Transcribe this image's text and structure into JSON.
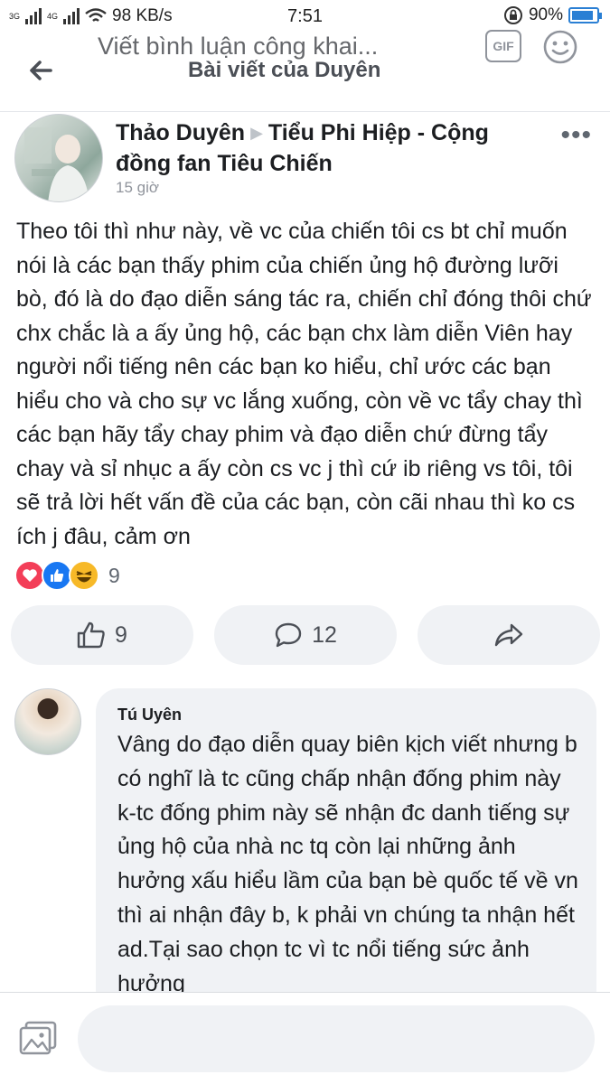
{
  "status_bar": {
    "network_left": "3G",
    "network_right": "4G",
    "speed": "98 KB/s",
    "time": "7:51",
    "battery": "90%",
    "battery_level": 0.9
  },
  "header": {
    "title": "Bài viết của Duyên"
  },
  "post": {
    "author": "Thảo Duyên",
    "group": "Tiểu Phi Hiệp - Cộng đồng fan Tiêu Chiến",
    "time": "15 giờ",
    "body": "Theo tôi thì như này, về vc của chiến tôi cs bt chỉ muốn nói là các bạn thấy phim của chiến ủng hộ đường lưỡi bò, đó là do đạo diễn sáng tác ra, chiến chỉ đóng thôi chứ chx chắc là a ấy ủng hộ, các bạn chx làm diễn Viên hay người nổi tiếng nên các bạn ko hiểu, chỉ ước các bạn hiểu cho và cho sự vc lắng xuống, còn về vc tẩy chay thì các bạn hãy tẩy chay phim và đạo diễn chứ đừng tẩy chay và sỉ nhục a ấy còn cs vc j thì cứ ib riêng vs tôi, tôi sẽ trả lời hết vấn đề của các bạn, còn cãi nhau thì ko cs ích j đâu, cảm ơn",
    "reaction_count": "9",
    "reactions": [
      "love",
      "like",
      "haha"
    ],
    "like_count": "9",
    "comment_count": "12"
  },
  "comment": {
    "author": "Tú Uyên",
    "body": "Vâng do đạo diễn quay biên kịch viết nhưng b có nghĩ là tc cũng chấp nhận đống phim này k-tc đống phim này sẽ nhận đc danh tiếng sự ủng hộ của nhà nc tq còn lại những ảnh hưởng xấu hiểu lầm của bạn bè quốc tế về vn thì ai nhận đây b, k phải vn chúng ta nhận hết ad.Tại sao chọn tc vì tc nổi tiếng sức ảnh hưởng"
  },
  "composer": {
    "placeholder": "Viết bình luận công khai...",
    "gif_label": "GIF"
  },
  "colors": {
    "accent": "#1877f2",
    "love": "#f33e58",
    "haha": "#f7b928",
    "pill_bg": "#f0f2f5"
  }
}
